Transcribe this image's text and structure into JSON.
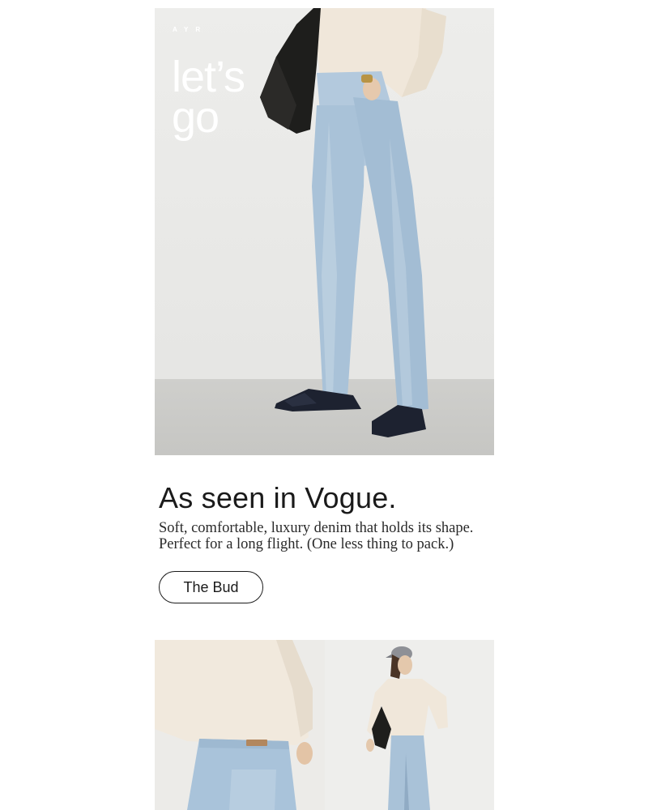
{
  "hero": {
    "brand": "AYR",
    "headline_line1": "let’s",
    "headline_line2": "go"
  },
  "feature": {
    "headline": "As seen in Vogue.",
    "body_line1": "Soft, comfortable, luxury denim that holds its shape.",
    "body_line2": "Perfect for a long flight. (One less thing to pack.)",
    "cta_label": "The Bud"
  },
  "colors": {
    "text": "#1a1a1a",
    "denim": "#a9c2d9",
    "sweater": "#efe6d8",
    "background": "#ffffff"
  }
}
